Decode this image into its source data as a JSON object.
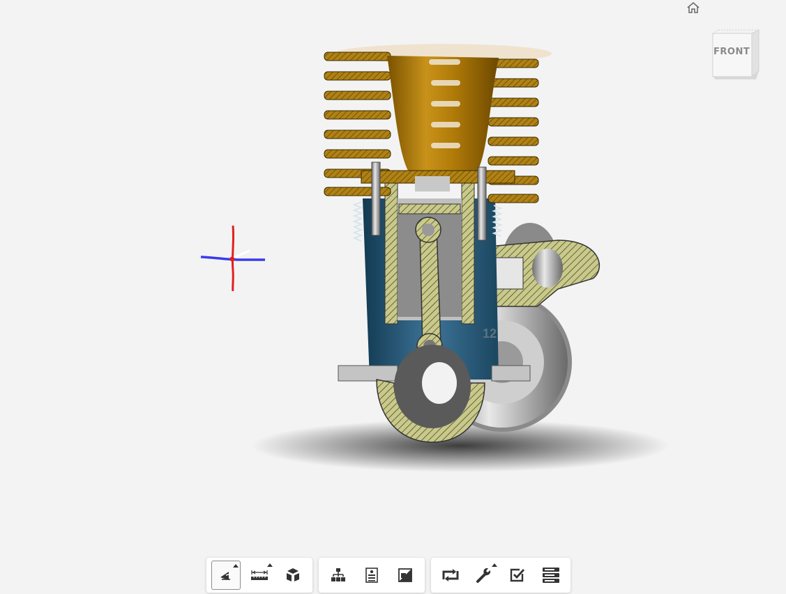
{
  "viewcube": {
    "face_label": "FRONT"
  },
  "model": {
    "part_label": "12"
  },
  "toolbar": {
    "groups": [
      {
        "buttons": [
          {
            "icon": "orbit-icon",
            "active": true,
            "has_menu": true
          },
          {
            "icon": "measure-icon",
            "active": false,
            "has_menu": true
          },
          {
            "icon": "explode-icon",
            "active": false,
            "has_menu": false
          }
        ]
      },
      {
        "buttons": [
          {
            "icon": "model-browser-icon",
            "active": false,
            "has_menu": false
          },
          {
            "icon": "properties-icon",
            "active": false,
            "has_menu": false
          },
          {
            "icon": "section-analysis-icon",
            "active": false,
            "has_menu": false
          }
        ]
      },
      {
        "buttons": [
          {
            "icon": "reset-view-icon",
            "active": false,
            "has_menu": false
          },
          {
            "icon": "settings-icon",
            "active": false,
            "has_menu": true
          },
          {
            "icon": "markup-icon",
            "active": false,
            "has_menu": false
          },
          {
            "icon": "layers-icon",
            "active": false,
            "has_menu": false
          }
        ]
      }
    ]
  },
  "colors": {
    "background": "#f3f3f3",
    "cooling_fins": "#b8860b",
    "crankcase": "#2f5f80",
    "section_hatch": "#c9c98a",
    "triad_x": "#e02020",
    "triad_y": "#3a3aee"
  }
}
